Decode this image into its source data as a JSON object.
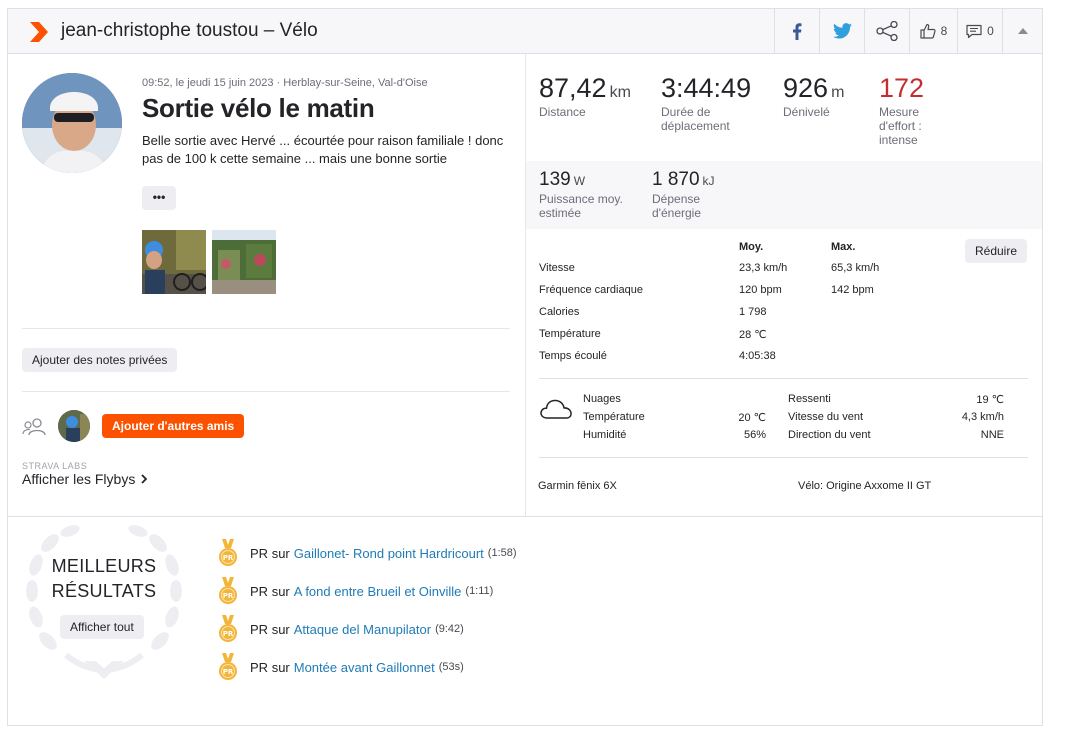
{
  "header": {
    "title": "jean-christophe toustou – Vélo",
    "kudos_count": "8",
    "comments_count": "0"
  },
  "activity": {
    "meta": "09:52, le jeudi 15 juin 2023 · Herblay-sur-Seine, Val-d'Oise",
    "title": "Sortie vélo le matin",
    "description": "Belle sortie avec Hervé ... écourtée pour raison familiale ! donc pas de 100 k cette semaine ... mais une bonne sortie",
    "more_label": "•••",
    "private_notes_label": "Ajouter des notes privées",
    "add_friends_label": "Ajouter d'autres amis",
    "labs_label": "STRAVA LABS",
    "flybys_label": "Afficher les Flybys"
  },
  "stats": {
    "distance": {
      "value": "87,42",
      "unit": "km",
      "label": "Distance"
    },
    "moving_time": {
      "value": "3:44:49",
      "label": "Durée de déplacement"
    },
    "elevation": {
      "value": "926",
      "unit": "m",
      "label": "Dénivelé"
    },
    "effort": {
      "value": "172",
      "label": "Mesure d'effort : intense"
    },
    "power": {
      "value": "139",
      "unit": "W",
      "label": "Puissance moy. estimée"
    },
    "energy": {
      "value": "1 870",
      "unit": "kJ",
      "label": "Dépense d'énergie"
    }
  },
  "details": {
    "col_avg": "Moy.",
    "col_max": "Max.",
    "reduce_label": "Réduire",
    "rows": [
      {
        "label": "Vitesse",
        "avg": "23,3 km/h",
        "max": "65,3 km/h"
      },
      {
        "label": "Fréquence cardiaque",
        "avg": "120 bpm",
        "max": "142 bpm"
      },
      {
        "label": "Calories",
        "avg": "1 798",
        "max": ""
      },
      {
        "label": "Température",
        "avg": "28 ℃",
        "max": ""
      },
      {
        "label": "Temps écoulé",
        "avg": "4:05:38",
        "max": ""
      }
    ]
  },
  "weather": {
    "condition": "Nuages",
    "temp_label": "Température",
    "temp_value": "20 ℃",
    "humidity_label": "Humidité",
    "humidity_value": "56%",
    "feels_label": "Ressenti",
    "feels_value": "19 ℃",
    "wind_speed_label": "Vitesse du vent",
    "wind_speed_value": "4,3 km/h",
    "wind_dir_label": "Direction du vent",
    "wind_dir_value": "NNE"
  },
  "gear": {
    "device": "Garmin fēnix 6X",
    "bike": "Vélo: Origine Axxome II GT"
  },
  "best_results": {
    "title_line1": "MEILLEURS",
    "title_line2": "RÉSULTATS",
    "show_all_label": "Afficher tout",
    "pr_prefix": "PR",
    "pr_on": "sur",
    "items": [
      {
        "segment": "Gaillonet- Rond point Hardricourt",
        "time": "(1:58)"
      },
      {
        "segment": "A fond entre Brueil et Oinville",
        "time": "(1:11)"
      },
      {
        "segment": "Attaque del Manupilator",
        "time": "(9:42)"
      },
      {
        "segment": "Montée avant Gaillonnet",
        "time": "(53s)"
      }
    ],
    "medal_label": "PR"
  },
  "colors": {
    "brand_orange": "#fc5200",
    "effort_red": "#c62d2f",
    "link_blue": "#1f7bb6",
    "medal_gold": "#f2b53a"
  }
}
